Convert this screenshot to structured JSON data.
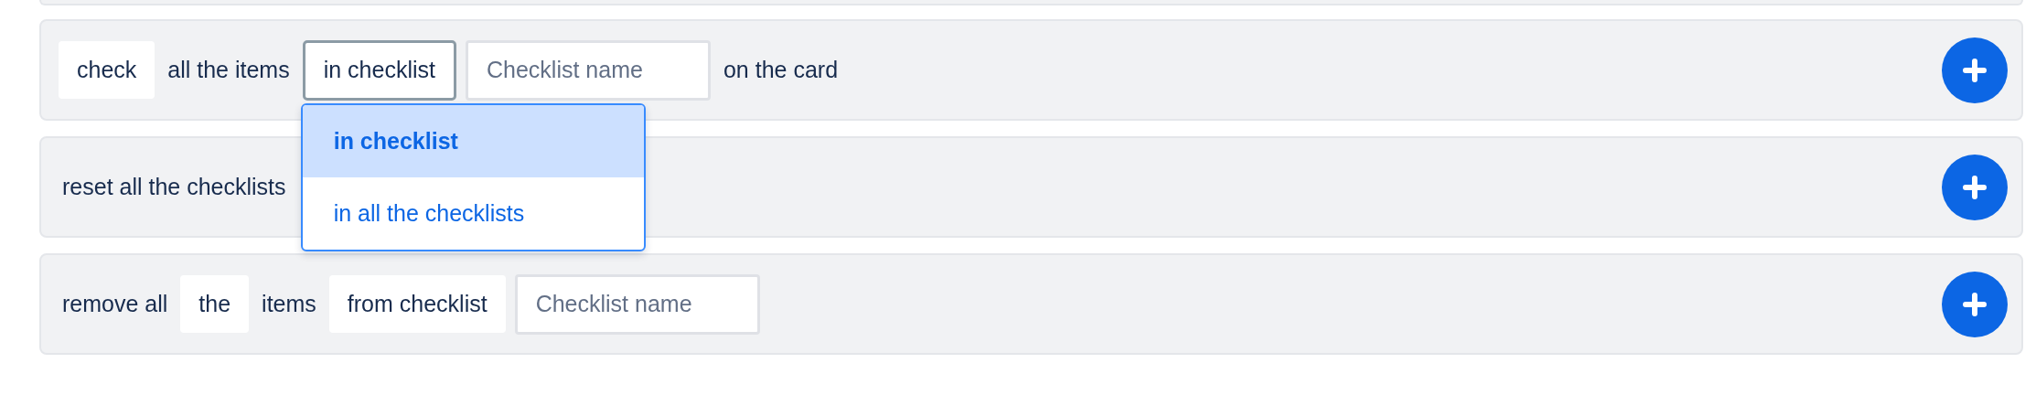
{
  "rows": [
    {
      "parts": [
        {
          "kind": "chip",
          "text": "check"
        },
        {
          "kind": "text",
          "text": "all the items"
        },
        {
          "kind": "select",
          "text": "in checklist",
          "open": true,
          "options": [
            {
              "label": "in checklist",
              "selected": true
            },
            {
              "label": "in all the checklists",
              "selected": false
            }
          ]
        },
        {
          "kind": "input",
          "placeholder": "Checklist name"
        },
        {
          "kind": "text",
          "text": "on the card"
        }
      ]
    },
    {
      "parts": [
        {
          "kind": "text",
          "text": "reset all the checklists"
        }
      ]
    },
    {
      "parts": [
        {
          "kind": "text",
          "text": "remove all"
        },
        {
          "kind": "chip",
          "text": "the"
        },
        {
          "kind": "text",
          "text": "items"
        },
        {
          "kind": "chip",
          "text": "from checklist"
        },
        {
          "kind": "input",
          "placeholder": "Checklist name"
        }
      ]
    }
  ]
}
